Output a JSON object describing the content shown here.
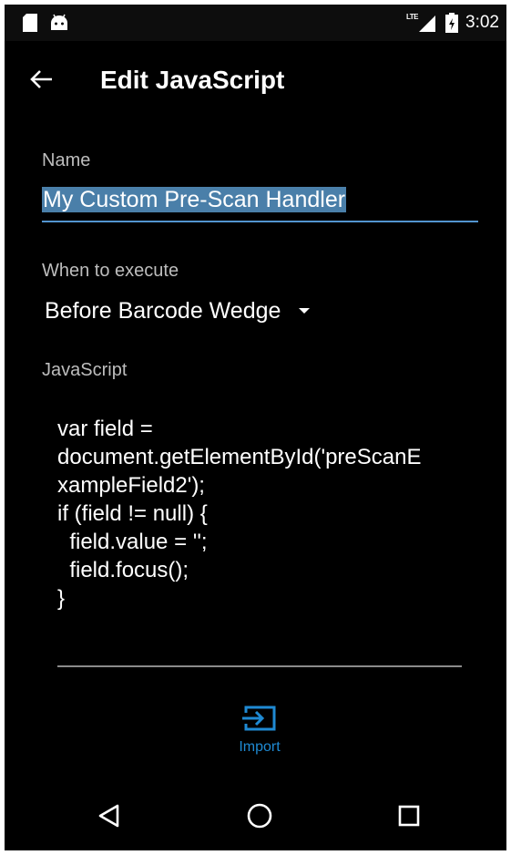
{
  "status_bar": {
    "network_label": "LTE",
    "time": "3:02",
    "icons": [
      "sd-card-icon",
      "android-icon",
      "lte-signal-icon",
      "battery-icon"
    ]
  },
  "app_bar": {
    "back_icon": "arrow-back-icon",
    "title": "Edit JavaScript"
  },
  "form": {
    "name_label": "Name",
    "name_value": "My Custom Pre-Scan Handler",
    "when_label": "When to execute",
    "when_value": "Before Barcode Wedge",
    "script_label": "JavaScript",
    "script_lines": [
      "var field =",
      "document.getElementById('preScanE",
      "xampleField2');",
      "if (field != null) {",
      "  field.value = '';",
      "  field.focus();",
      "}"
    ]
  },
  "actions": {
    "import_label": "Import",
    "import_icon": "import-icon"
  },
  "nav_bar": {
    "buttons": [
      "back-triangle-icon",
      "home-circle-icon",
      "recents-square-icon"
    ]
  },
  "colors": {
    "background": "#000000",
    "accent": "#1f8ad3",
    "selection": "#4a7fa9",
    "input_underline": "#5294cf"
  }
}
